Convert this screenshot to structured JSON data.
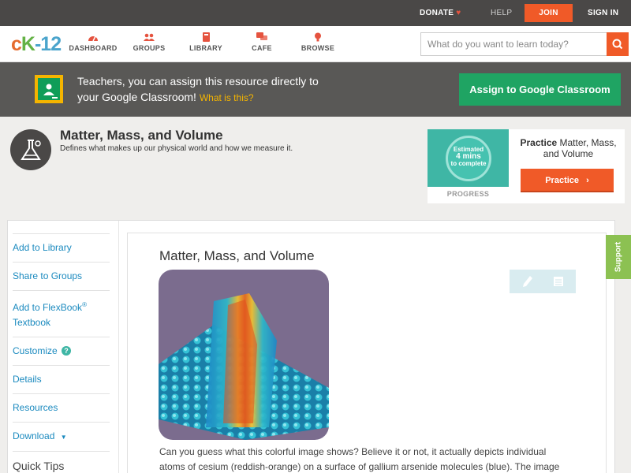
{
  "topbar": {
    "donate": "DONATE",
    "help": "HELP",
    "join": "JOIN",
    "signin": "SIGN IN"
  },
  "logo": {
    "c": "c",
    "k": "K",
    "dash": "-",
    "num": "12"
  },
  "nav": {
    "items": [
      {
        "label": "DASHBOARD",
        "icon": "dashboard-icon"
      },
      {
        "label": "GROUPS",
        "icon": "groups-icon"
      },
      {
        "label": "LIBRARY",
        "icon": "library-icon"
      },
      {
        "label": "CAFE",
        "icon": "cafe-icon"
      },
      {
        "label": "BROWSE",
        "icon": "browse-icon"
      }
    ]
  },
  "search": {
    "placeholder": "What do you want to learn today?"
  },
  "classroom": {
    "line1": "Teachers, you can assign this resource directly to",
    "line2": "your Google Classroom!",
    "what": "What is this?",
    "assign_label": "Assign to Google Classroom"
  },
  "concept": {
    "title": "Matter, Mass, and Volume",
    "description": "Defines what makes up our physical world and how we measure it."
  },
  "practice": {
    "ring_line1": "Estimated",
    "ring_line2": "4 mins",
    "ring_line3": "to complete",
    "progress_label": "PROGRESS",
    "title_bold": "Practice",
    "title_rest": " Matter, Mass, and Volume",
    "button_label": "Practice"
  },
  "sidebar": {
    "add_library": "Add to Library",
    "share_groups": "Share to Groups",
    "add_flexbook_1": "Add to FlexBook",
    "add_flexbook_reg": "®",
    "add_flexbook_2": "Textbook",
    "customize": "Customize",
    "details": "Details",
    "resources": "Resources",
    "download": "Download",
    "download_arrow": "▼",
    "quick_tips": "Quick Tips"
  },
  "article": {
    "title": "Matter, Mass, and Volume",
    "body": "Can you guess what this colorful image shows? Believe it or not, it actually depicts individual atoms of cesium (reddish-orange) on a surface of gallium arsenide molecules (blue). The image"
  },
  "support": {
    "label": "Support"
  },
  "colors": {
    "accent": "#f05a28",
    "link": "#1b8abf",
    "classroom_green": "#1fa463",
    "support_green": "#8cc152"
  }
}
